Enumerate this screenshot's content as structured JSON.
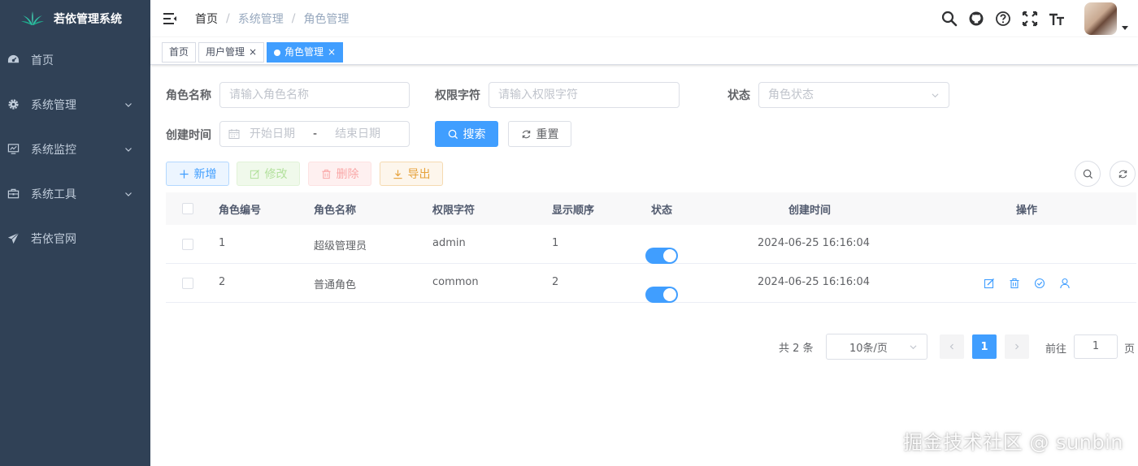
{
  "app": {
    "title": "若依管理系统"
  },
  "sidebar": {
    "items": [
      {
        "label": "首页",
        "icon": "dashboard-icon",
        "has_arrow": false
      },
      {
        "label": "系统管理",
        "icon": "gear-icon",
        "has_arrow": true
      },
      {
        "label": "系统监控",
        "icon": "monitor-icon",
        "has_arrow": true
      },
      {
        "label": "系统工具",
        "icon": "toolbox-icon",
        "has_arrow": true
      },
      {
        "label": "若依官网",
        "icon": "paper-plane-icon",
        "has_arrow": false
      }
    ]
  },
  "breadcrumb": [
    "首页",
    "系统管理",
    "角色管理"
  ],
  "tags": [
    {
      "label": "首页",
      "active": false,
      "closable": false
    },
    {
      "label": "用户管理",
      "active": false,
      "closable": true
    },
    {
      "label": "角色管理",
      "active": true,
      "closable": true
    }
  ],
  "search_form": {
    "role_name_label": "角色名称",
    "role_name_placeholder": "请输入角色名称",
    "role_key_label": "权限字符",
    "role_key_placeholder": "请输入权限字符",
    "status_label": "状态",
    "status_placeholder": "角色状态",
    "created_label": "创建时间",
    "start_placeholder": "开始日期",
    "range_sep": "-",
    "end_placeholder": "结束日期",
    "search_button": "搜索",
    "reset_button": "重置"
  },
  "toolbar": {
    "add": "新增",
    "edit": "修改",
    "delete": "删除",
    "export": "导出"
  },
  "table": {
    "headers": [
      "角色编号",
      "角色名称",
      "权限字符",
      "显示顺序",
      "状态",
      "创建时间",
      "操作"
    ],
    "rows": [
      {
        "id": "1",
        "name": "超级管理员",
        "key": "admin",
        "sort": "1",
        "status": true,
        "created": "2024-06-25 16:16:04",
        "actions": false
      },
      {
        "id": "2",
        "name": "普通角色",
        "key": "common",
        "sort": "2",
        "status": true,
        "created": "2024-06-25 16:16:04",
        "actions": true
      }
    ]
  },
  "pagination": {
    "total": "共 2 条",
    "page_size": "10条/页",
    "current_page": "1",
    "goto_label": "前往",
    "goto_value": "1",
    "page_suffix": "页"
  },
  "watermark": "掘金技术社区 @ sunbin",
  "colors": {
    "sidebar_bg": "#304156",
    "primary": "#409eff",
    "success": "#67c23a",
    "danger": "#f56c6c",
    "warning": "#e6a23c"
  }
}
